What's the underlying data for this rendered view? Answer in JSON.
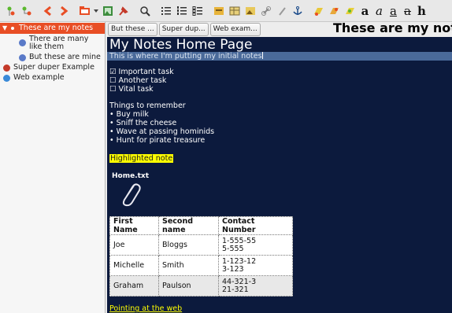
{
  "toolbar": {
    "icons": [
      "node-add-icon",
      "node-sub-icon",
      "back-icon",
      "forward-icon",
      "folder-icon",
      "chevron-down-icon",
      "image-icon",
      "pin-icon",
      "search-icon",
      "bullet-list-icon",
      "numbered-list-icon",
      "todo-list-icon",
      "codebox-icon",
      "table-icon",
      "image-insert-icon",
      "link-icon",
      "attach-icon",
      "anchor-icon",
      "highlighter-icon",
      "color-icon",
      "bg-color-icon"
    ],
    "format": {
      "bold": "a",
      "italic": "a",
      "underline": "a",
      "strike": "a",
      "heading": "h"
    }
  },
  "tree": {
    "items": [
      {
        "label": "These are my notes",
        "selected": true,
        "bullet": "#e84e25"
      },
      {
        "label": "There are many like them",
        "selected": false,
        "bullet": "#5a7ac8"
      },
      {
        "label": "But these are mine",
        "selected": false,
        "bullet": "#5a7ac8"
      },
      {
        "label": "Super duper Example",
        "selected": false,
        "bullet": "#c43a2a"
      },
      {
        "label": "Web example",
        "selected": false,
        "bullet": "#3a8ad8"
      }
    ]
  },
  "tabs": [
    "But these ...",
    "Super dup...",
    "Web exam..."
  ],
  "header_title": "These are my not",
  "note": {
    "heading": "My Notes Home Page",
    "subheading": "This is where I'm putting my initial notes",
    "todo": [
      "☑ Important task",
      "☐ Another task",
      "☐ Vital task"
    ],
    "remember_title": "Things to remember",
    "remember": [
      "• Buy milk",
      "• Sniff the cheese",
      "• Wave at passing hominids",
      "• Hunt for pirate treasure"
    ],
    "highlight": "Highlighted note",
    "attachment": "Home.txt",
    "table": {
      "headers": [
        "First Name",
        "Second name",
        "Contact Number"
      ],
      "rows": [
        [
          "Joe",
          "Bloggs",
          "1-555-55\n5-555"
        ],
        [
          "Michelle",
          "Smith",
          "1-123-12\n3-123"
        ],
        [
          "Graham",
          "Paulson",
          "44-321-3\n21-321"
        ]
      ]
    },
    "link": "Pointing at the web"
  },
  "colors": {
    "accent": "#e84e25",
    "note_bg": "#0c1a3d",
    "highlight": "#ffff00"
  }
}
